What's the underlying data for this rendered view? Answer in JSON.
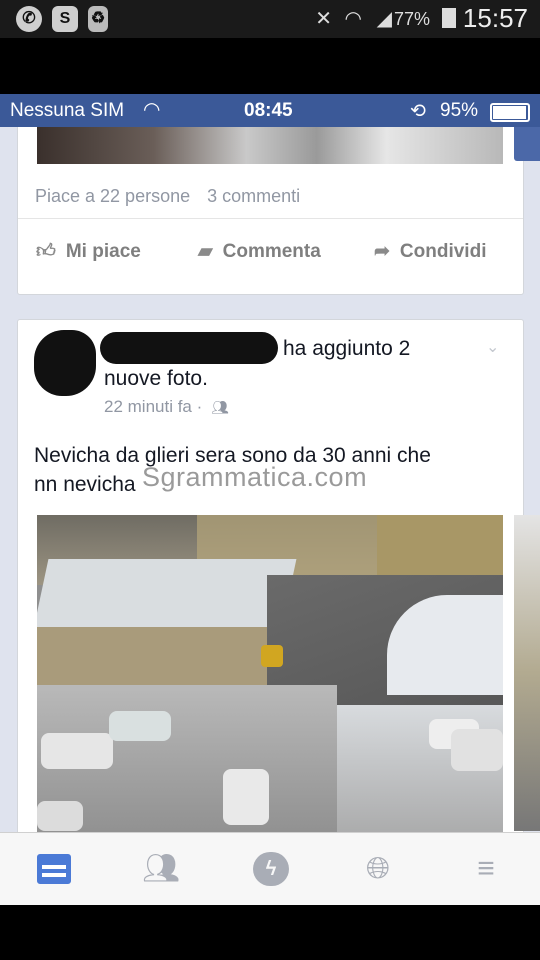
{
  "android_status": {
    "battery": "77%",
    "time": "15:57"
  },
  "ios_status": {
    "carrier": "Nessuna SIM",
    "time": "08:45",
    "battery": "95%"
  },
  "post_prev": {
    "likes": "Piace a 22 persone",
    "comments": "3 commenti",
    "actions": {
      "like": "Mi piace",
      "comment": "Commenta",
      "share": "Condividi"
    }
  },
  "post": {
    "action_text": "ha aggiunto 2",
    "action_text2": "nuove foto.",
    "time": "22 minuti fa ·",
    "body_line1": "Nevicha da glieri sera sono da 30 anni che",
    "body_line2": "nn nevicha",
    "watermark": "Sgrammatica.com"
  },
  "nav": {
    "icons": [
      "news-feed-icon",
      "friends-icon",
      "messenger-icon",
      "globe-icon",
      "menu-icon"
    ]
  }
}
